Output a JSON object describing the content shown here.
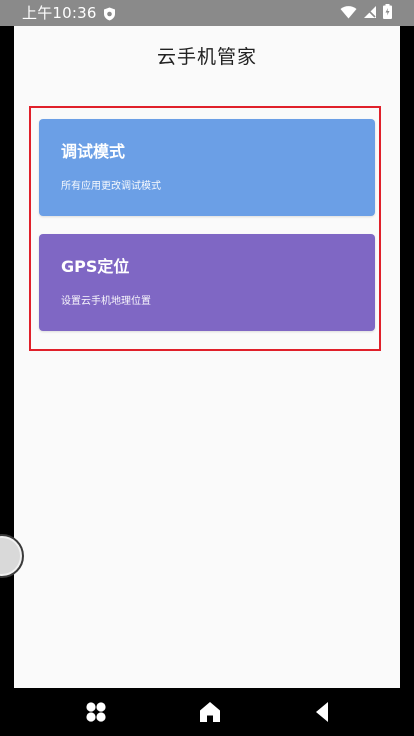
{
  "status_bar": {
    "time": "上午10:36"
  },
  "page": {
    "title": "云手机管家"
  },
  "cards": [
    {
      "title": "调试模式",
      "subtitle": "所有应用更改调试模式",
      "color": "#6b9fe6"
    },
    {
      "title": "GPS定位",
      "subtitle": "设置云手机地理位置",
      "color": "#7f67c4"
    }
  ],
  "colors": {
    "status_bar_bg": "#8a8a8a",
    "app_bg": "#fafafa",
    "highlight_border": "#e0202a"
  },
  "icons": {
    "status": [
      "shield-icon",
      "wifi-icon",
      "no-sim-icon",
      "battery-icon"
    ],
    "nav": [
      "apps-icon",
      "home-icon",
      "back-icon"
    ]
  }
}
